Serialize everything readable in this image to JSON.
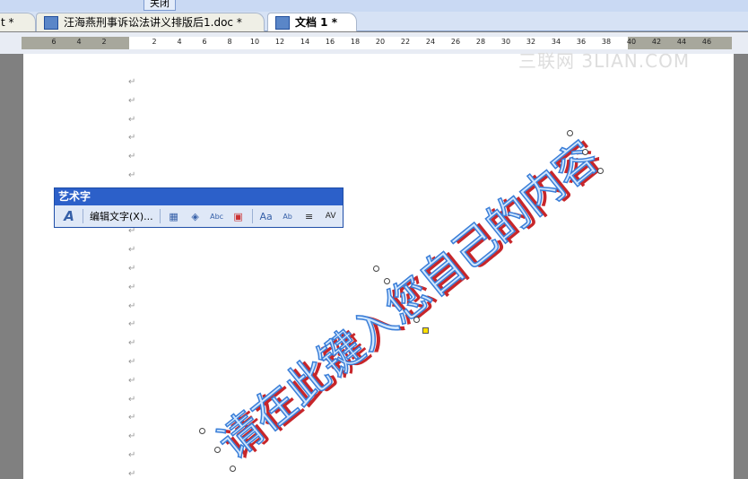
{
  "toolbar_top": {
    "close_label": "关闭"
  },
  "tabs": [
    {
      "label": "t *"
    },
    {
      "label": "汪海燕刑事诉讼法讲义排版后1.doc *"
    },
    {
      "label": "文档 1 *"
    }
  ],
  "ruler": {
    "ticks": [
      "6",
      "4",
      "2",
      "2",
      "4",
      "6",
      "8",
      "10",
      "12",
      "14",
      "16",
      "18",
      "20",
      "22",
      "24",
      "26",
      "28",
      "30",
      "32",
      "34",
      "36",
      "38",
      "40",
      "42",
      "44",
      "46"
    ]
  },
  "watermark": "三联网 3LIAN.COM",
  "wordart_toolbar": {
    "title": "艺术字",
    "edit_text": "编辑文字(X)..."
  },
  "wordart_text": "请在此键入您自己的内容",
  "paragraph_mark": "↵"
}
